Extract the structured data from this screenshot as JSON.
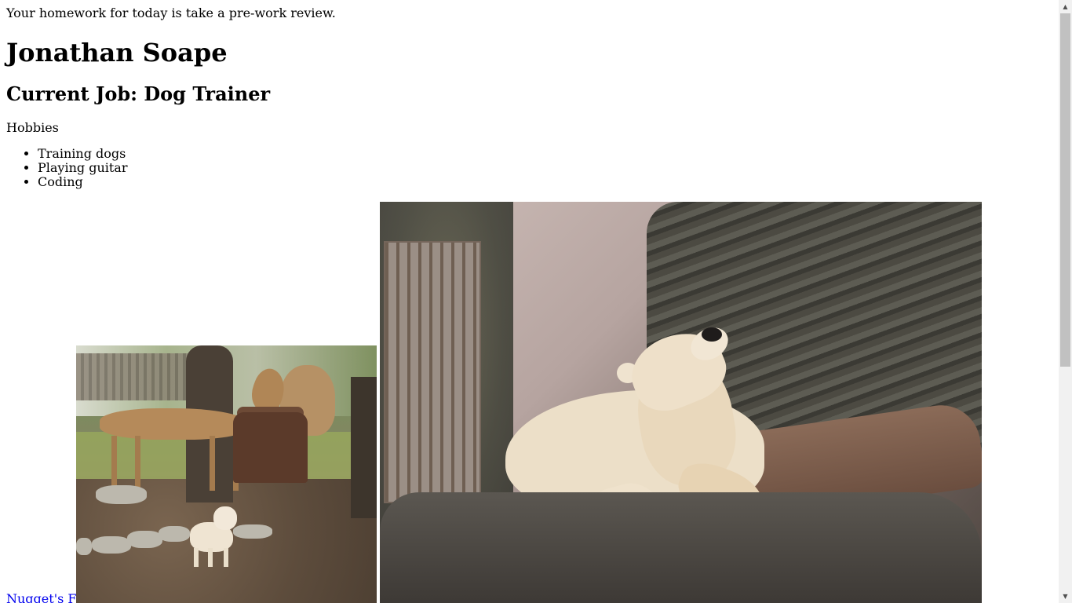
{
  "intro_text": "Your homework for today is take a pre-work review.",
  "name": "Jonathan Soape",
  "job_heading": "Current Job: Dog Trainer",
  "hobbies_label": "Hobbies",
  "hobbies": [
    "Training dogs",
    "Playing guitar",
    "Coding"
  ],
  "link_text": "Nugget's FB!",
  "scrollbar": {
    "up_glyph": "▲",
    "down_glyph": "▼",
    "position_fraction": 0.0
  }
}
